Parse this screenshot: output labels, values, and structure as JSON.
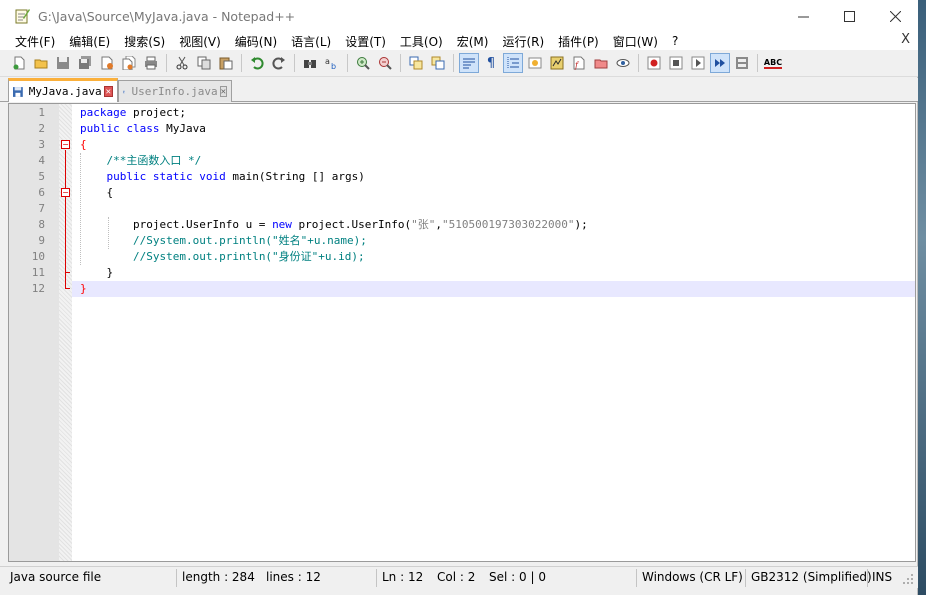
{
  "window": {
    "title": "G:\\Java\\Source\\MyJava.java - Notepad++",
    "menu_close": "X"
  },
  "menu": [
    "文件(F)",
    "编辑(E)",
    "搜索(S)",
    "视图(V)",
    "编码(N)",
    "语言(L)",
    "设置(T)",
    "工具(O)",
    "宏(M)",
    "运行(R)",
    "插件(P)",
    "窗口(W)",
    "?"
  ],
  "toolbar": {
    "icons": [
      "new-file-icon",
      "open-file-icon",
      "save-icon",
      "save-all-icon",
      "close-icon",
      "close-all-icon",
      "print-icon",
      "cut-icon",
      "copy-icon",
      "paste-icon",
      "undo-icon",
      "redo-icon",
      "find-icon",
      "replace-icon",
      "zoom-in-icon",
      "zoom-out-icon",
      "sync-v-icon",
      "sync-h-icon",
      "wrap-icon",
      "all-chars-icon",
      "indent-guide-icon",
      "udl-icon",
      "doc-map-icon",
      "function-list-icon",
      "folder-icon",
      "monitor-icon",
      "record-icon",
      "stop-icon",
      "play-icon",
      "play-multi-icon",
      "save-macro-icon",
      "spellcheck-icon"
    ],
    "spellcheck_label": "ABC"
  },
  "tabs": [
    {
      "label": "MyJava.java",
      "active": true
    },
    {
      "label": "UserInfo.java",
      "active": false
    }
  ],
  "editor": {
    "line_numbers": [
      "1",
      "2",
      "3",
      "4",
      "5",
      "6",
      "7",
      "8",
      "9",
      "10",
      "11",
      "12"
    ],
    "lines": [
      {
        "segments": [
          {
            "t": "package",
            "c": "kw"
          },
          {
            "t": " project;",
            "c": ""
          }
        ]
      },
      {
        "segments": [
          {
            "t": "public",
            "c": "kw"
          },
          {
            "t": " ",
            "c": ""
          },
          {
            "t": "class",
            "c": "kw"
          },
          {
            "t": " MyJava",
            "c": ""
          }
        ]
      },
      {
        "segments": [
          {
            "t": "{",
            "c": "br"
          }
        ]
      },
      {
        "segments": [
          {
            "t": "    ",
            "c": ""
          },
          {
            "t": "/**主函数入口 */",
            "c": "cm"
          }
        ]
      },
      {
        "segments": [
          {
            "t": "    ",
            "c": ""
          },
          {
            "t": "public",
            "c": "kw"
          },
          {
            "t": " ",
            "c": ""
          },
          {
            "t": "static",
            "c": "kw"
          },
          {
            "t": " ",
            "c": ""
          },
          {
            "t": "void",
            "c": "kw"
          },
          {
            "t": " main(String [] args)",
            "c": ""
          }
        ]
      },
      {
        "segments": [
          {
            "t": "    {",
            "c": ""
          }
        ]
      },
      {
        "segments": []
      },
      {
        "segments": [
          {
            "t": "        project.UserInfo u = ",
            "c": ""
          },
          {
            "t": "new",
            "c": "kw"
          },
          {
            "t": " project.UserInfo(",
            "c": ""
          },
          {
            "t": "\"张\"",
            "c": "str"
          },
          {
            "t": ",",
            "c": ""
          },
          {
            "t": "\"510500197303022000\"",
            "c": "str"
          },
          {
            "t": ");",
            "c": ""
          }
        ]
      },
      {
        "segments": [
          {
            "t": "        ",
            "c": ""
          },
          {
            "t": "//System.out.println(\"姓名\"+u.name);",
            "c": "cm"
          }
        ]
      },
      {
        "segments": [
          {
            "t": "        ",
            "c": ""
          },
          {
            "t": "//System.out.println(\"身份证\"+u.id);",
            "c": "cm"
          }
        ]
      },
      {
        "segments": [
          {
            "t": "    }",
            "c": ""
          }
        ]
      },
      {
        "segments": [
          {
            "t": "}",
            "c": "br"
          }
        ]
      }
    ],
    "current_line": 12
  },
  "status": {
    "file_type": "Java source file",
    "length": "length : 284",
    "lines": "lines : 12",
    "ln": "Ln : 12",
    "col": "Col : 2",
    "sel": "Sel : 0 | 0",
    "eol": "Windows (CR LF)",
    "encoding": "GB2312 (Simplified)",
    "mode": "INS"
  }
}
